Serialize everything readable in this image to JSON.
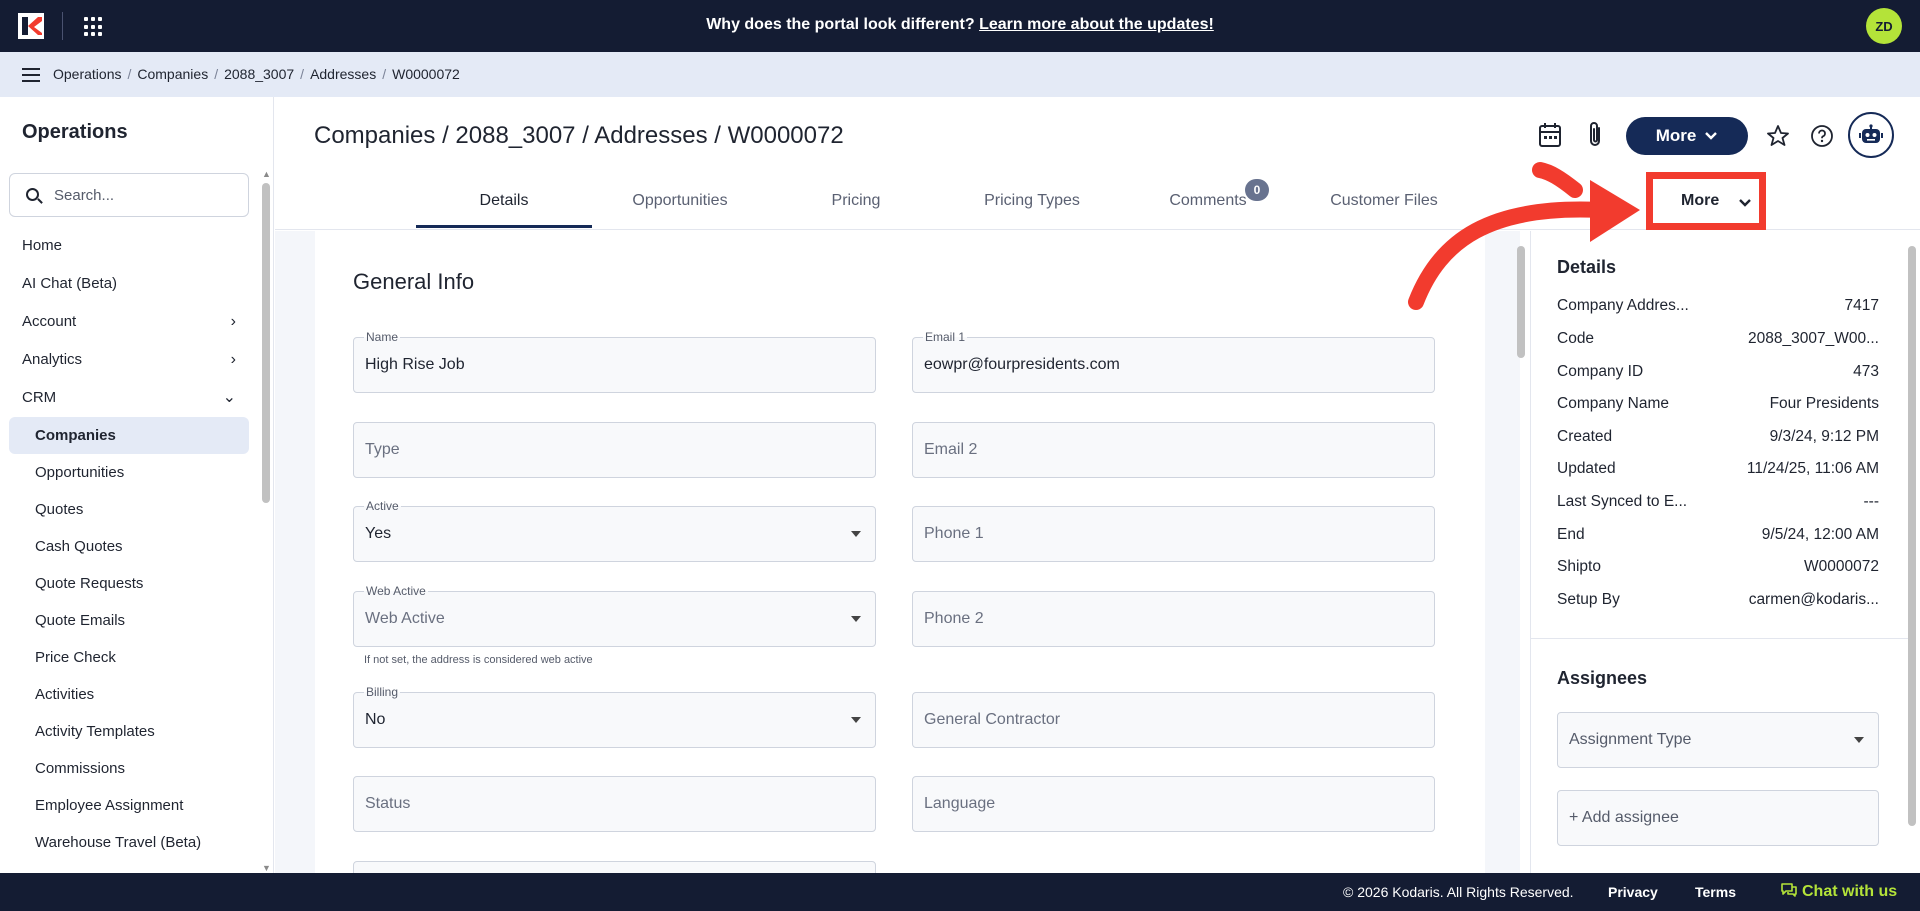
{
  "banner": {
    "question": "Why does the portal look different?",
    "link": "Learn more about the updates!"
  },
  "user": {
    "initials": "ZD"
  },
  "breadcrumb": [
    "Operations",
    "Companies",
    "2088_3007",
    "Addresses",
    "W0000072"
  ],
  "sidebar": {
    "title": "Operations",
    "search_placeholder": "Search...",
    "items": [
      {
        "label": "Home"
      },
      {
        "label": "AI Chat (Beta)"
      },
      {
        "label": "Account",
        "chevron": "›"
      },
      {
        "label": "Analytics",
        "chevron": "›"
      },
      {
        "label": "CRM",
        "chevron": "⌄"
      }
    ],
    "crm_items": [
      "Companies",
      "Opportunities",
      "Quotes",
      "Cash Quotes",
      "Quote Requests",
      "Quote Emails",
      "Price Check",
      "Activities",
      "Activity Templates",
      "Commissions",
      "Employee Assignment",
      "Warehouse Travel (Beta)"
    ],
    "active_item": "Companies"
  },
  "page": {
    "title": "Companies / 2088_3007 / Addresses / W0000072",
    "more_button": "More"
  },
  "tabs": {
    "items": [
      "Details",
      "Opportunities",
      "Pricing",
      "Pricing Types",
      "Comments",
      "Customer Files"
    ],
    "active": "Details",
    "comments_count": "0",
    "more_label": "More"
  },
  "form": {
    "section_title": "General Info",
    "name_label": "Name",
    "name_value": "High Rise Job",
    "email1_label": "Email 1",
    "email1_value": "eowpr@fourpresidents.com",
    "type_placeholder": "Type",
    "email2_placeholder": "Email 2",
    "active_label": "Active",
    "active_value": "Yes",
    "phone1_placeholder": "Phone 1",
    "web_active_label": "Web Active",
    "web_active_placeholder": "Web Active",
    "web_active_hint": "If not set, the address is considered web active",
    "phone2_placeholder": "Phone 2",
    "billing_label": "Billing",
    "billing_value": "No",
    "general_contractor_placeholder": "General Contractor",
    "status_placeholder": "Status",
    "language_placeholder": "Language"
  },
  "details": {
    "title": "Details",
    "rows": [
      {
        "key": "Company Addres...",
        "value": "7417"
      },
      {
        "key": "Code",
        "value": "2088_3007_W00..."
      },
      {
        "key": "Company ID",
        "value": "473"
      },
      {
        "key": "Company Name",
        "value": "Four Presidents"
      },
      {
        "key": "Created",
        "value": "9/3/24, 9:12 PM"
      },
      {
        "key": "Updated",
        "value": "11/24/25, 11:06 AM"
      },
      {
        "key": "Last Synced to E...",
        "value": "---"
      },
      {
        "key": "End",
        "value": "9/5/24, 12:00 AM"
      },
      {
        "key": "Shipto",
        "value": "W0000072"
      },
      {
        "key": "Setup By",
        "value": "carmen@kodaris..."
      }
    ]
  },
  "assignees": {
    "title": "Assignees",
    "type_placeholder": "Assignment Type",
    "add_label": "+ Add assignee"
  },
  "footer": {
    "copyright": "© 2026 Kodaris. All Rights Reserved.",
    "privacy": "Privacy",
    "terms": "Terms",
    "chat": "Chat with us"
  },
  "colors": {
    "navy": "#141c33",
    "button_navy": "#152a57",
    "accent_lime": "#b4e339",
    "highlight_red": "#f23b2e",
    "crumb_bg": "#e4eaf6"
  },
  "icons": [
    "kodaris-logo-icon",
    "apps-grid-icon",
    "hamburger-icon",
    "search-icon",
    "calendar-icon",
    "paperclip-icon",
    "chevron-down-icon",
    "star-icon",
    "help-icon",
    "robot-icon",
    "chat-icon"
  ]
}
